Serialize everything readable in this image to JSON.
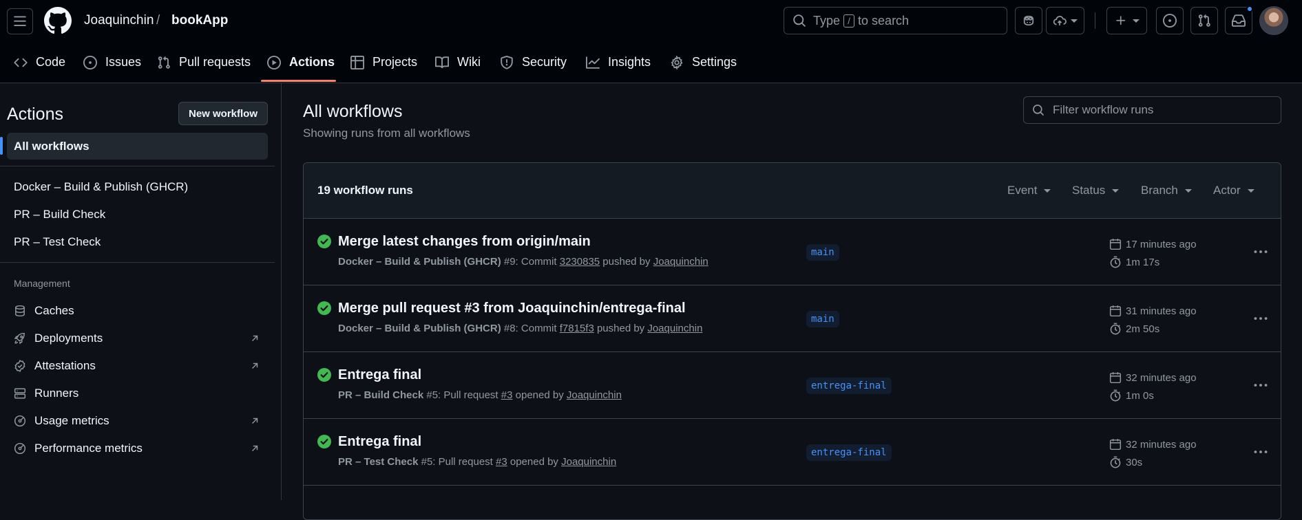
{
  "header": {
    "owner": "Joaquinchin",
    "separator": "/",
    "repo": "bookApp",
    "search": {
      "prefix": "Type",
      "key": "/",
      "suffix": "to search"
    },
    "icons": [
      "hamburger-icon",
      "github-logo-icon",
      "search-icon",
      "copilot-icon",
      "copilot-cloud-icon",
      "plus-icon",
      "issue-icon",
      "pull-request-icon",
      "inbox-icon"
    ]
  },
  "tabs": [
    {
      "label": "Code",
      "icon": "code-icon"
    },
    {
      "label": "Issues",
      "icon": "issue-icon"
    },
    {
      "label": "Pull requests",
      "icon": "pull-request-icon"
    },
    {
      "label": "Actions",
      "icon": "play-icon",
      "active": true
    },
    {
      "label": "Projects",
      "icon": "table-icon"
    },
    {
      "label": "Wiki",
      "icon": "book-icon"
    },
    {
      "label": "Security",
      "icon": "shield-icon"
    },
    {
      "label": "Insights",
      "icon": "graph-icon"
    },
    {
      "label": "Settings",
      "icon": "gear-icon"
    }
  ],
  "sidebar": {
    "title": "Actions",
    "new_workflow": "New workflow",
    "all_workflows": "All workflows",
    "workflows": [
      "Docker – Build & Publish (GHCR)",
      "PR – Build Check",
      "PR – Test Check"
    ],
    "management_label": "Management",
    "management": [
      {
        "label": "Caches",
        "icon": "database-icon",
        "external": false
      },
      {
        "label": "Deployments",
        "icon": "rocket-icon",
        "external": true
      },
      {
        "label": "Attestations",
        "icon": "verified-icon",
        "external": true
      },
      {
        "label": "Runners",
        "icon": "server-icon",
        "external": false
      },
      {
        "label": "Usage metrics",
        "icon": "meter-icon",
        "external": true
      },
      {
        "label": "Performance metrics",
        "icon": "meter-icon",
        "external": true
      }
    ]
  },
  "main": {
    "title": "All workflows",
    "subtitle": "Showing runs from all workflows",
    "filter_placeholder": "Filter workflow runs",
    "runs_count": "19 workflow runs",
    "filters": [
      "Event",
      "Status",
      "Branch",
      "Actor"
    ],
    "runs": [
      {
        "title": "Merge latest changes from origin/main",
        "workflow": "Docker – Build & Publish (GHCR)",
        "meta_mid": " #9: Commit ",
        "ref": "3230835",
        "meta_verb": " pushed by ",
        "actor": "Joaquinchin",
        "branch": "main",
        "time": "17 minutes ago",
        "duration": "1m 17s"
      },
      {
        "title": "Merge pull request #3 from Joaquinchin/entrega-final",
        "workflow": "Docker – Build & Publish (GHCR)",
        "meta_mid": " #8: Commit ",
        "ref": "f7815f3",
        "meta_verb": " pushed by ",
        "actor": "Joaquinchin",
        "branch": "main",
        "time": "31 minutes ago",
        "duration": "2m 50s"
      },
      {
        "title": "Entrega final",
        "workflow": "PR – Build Check",
        "meta_mid": " #5: Pull request ",
        "ref": "#3",
        "meta_verb": " opened by ",
        "actor": "Joaquinchin",
        "branch": "entrega-final",
        "time": "32 minutes ago",
        "duration": "1m 0s"
      },
      {
        "title": "Entrega final",
        "workflow": "PR – Test Check",
        "meta_mid": " #5: Pull request ",
        "ref": "#3",
        "meta_verb": " opened by ",
        "actor": "Joaquinchin",
        "branch": "entrega-final",
        "time": "32 minutes ago",
        "duration": "30s"
      }
    ]
  },
  "colors": {
    "background": "#0d1117",
    "header": "#010409",
    "accent": "#4493f8",
    "success": "#3fb950",
    "tab_underline": "#f78166"
  }
}
